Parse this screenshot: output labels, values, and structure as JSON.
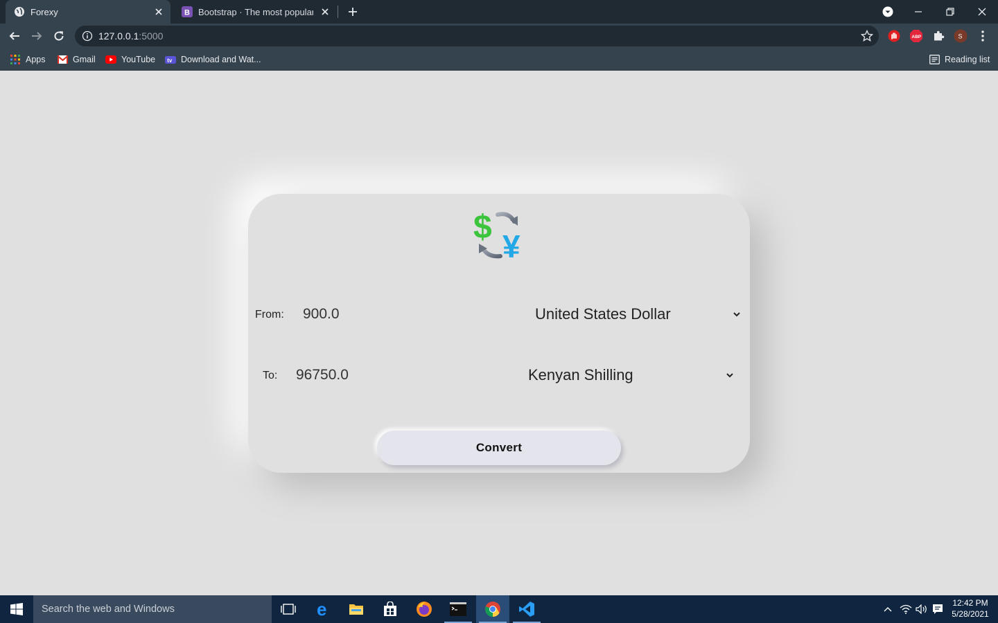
{
  "browser": {
    "tabs": [
      {
        "title": "Forexy",
        "active": true
      },
      {
        "title": "Bootstrap · The most popular HTML",
        "active": false
      }
    ],
    "address": {
      "host": "127.0.0.1",
      "port": ":5000"
    },
    "bookmarks": [
      {
        "label": "Apps"
      },
      {
        "label": "Gmail"
      },
      {
        "label": "YouTube"
      },
      {
        "label": "Download and Wat..."
      }
    ],
    "reading_list": "Reading list",
    "profile_initial": "S",
    "abp_label": "ABP"
  },
  "converter": {
    "from_label": "From:",
    "from_amount": "900.0",
    "from_currency": "United States Dollar",
    "to_label": "To:",
    "to_amount": "96750.0",
    "to_currency": "Kenyan Shilling",
    "convert_label": "Convert"
  },
  "taskbar": {
    "search_placeholder": "Search the web and Windows",
    "time": "12:42 PM",
    "date": "5/28/2021"
  },
  "colors": {
    "page_bg": "#e0e0e0",
    "tabbar_bg": "#202a32",
    "toolbar_bg": "#35434e",
    "taskbar_bg": "#0f2540",
    "dollar_green": "#3cc43c",
    "yen_blue": "#22a8e6"
  }
}
